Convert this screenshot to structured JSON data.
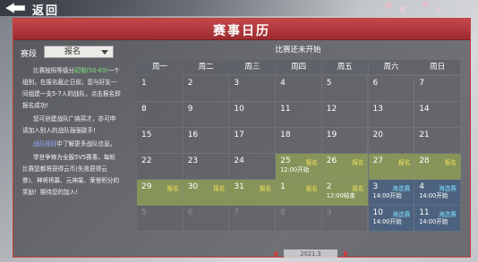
{
  "header": {
    "back_label": "返回"
  },
  "panel": {
    "title": "赛事日历"
  },
  "sidebar": {
    "segment_label": "赛段",
    "segment_value": "报名",
    "desc": {
      "p1_a": "比赛按照等级分",
      "p1_range": "初期(50-69)",
      "p1_b": "一个组别，在报名截止日前，您与好友一同组建一支5-7人的战队，点击报名即报名成功!",
      "p2": "您可创建战队广纳英才，亦可申请加入别人的战队强强联手!",
      "p3_link": "战队规则",
      "p3_b": "中了解更多战队信息。",
      "p4": "举世争锋为全服5V5赛事，每轮比赛您都将获得云币(失败获得云券)、神将将募、元神果、荣誉积分的奖励！期待您的加入!"
    }
  },
  "calendar": {
    "status": "比赛还未开始",
    "weekdays": [
      "周一",
      "周二",
      "周三",
      "周四",
      "周五",
      "周六",
      "周日"
    ],
    "rows": [
      [
        {
          "d": "1"
        },
        {
          "d": "2"
        },
        {
          "d": "3"
        },
        {
          "d": "4"
        },
        {
          "d": "5"
        },
        {
          "d": "6"
        },
        {
          "d": "7"
        }
      ],
      [
        {
          "d": "8"
        },
        {
          "d": "9"
        },
        {
          "d": "10"
        },
        {
          "d": "11"
        },
        {
          "d": "12"
        },
        {
          "d": "13"
        },
        {
          "d": "14"
        }
      ],
      [
        {
          "d": "15"
        },
        {
          "d": "16"
        },
        {
          "d": "17"
        },
        {
          "d": "18"
        },
        {
          "d": "19"
        },
        {
          "d": "20"
        },
        {
          "d": "21"
        }
      ],
      [
        {
          "d": "22"
        },
        {
          "d": "23"
        },
        {
          "d": "24"
        },
        {
          "d": "25",
          "tag": "报名",
          "sub": "12:00开始",
          "style": "reg"
        },
        {
          "d": "26",
          "tag": "报名",
          "style": "reg"
        },
        {
          "d": "27",
          "tag": "报名",
          "style": "reg"
        },
        {
          "d": "28",
          "tag": "报名",
          "style": "reg"
        }
      ],
      [
        {
          "d": "29",
          "tag": "报名",
          "style": "reg"
        },
        {
          "d": "30",
          "tag": "报名",
          "style": "reg"
        },
        {
          "d": "31",
          "tag": "报名",
          "style": "reg"
        },
        {
          "d": "1",
          "tag": "报名",
          "style": "reg"
        },
        {
          "d": "2",
          "tag": "报名",
          "sub": "12:00结束",
          "style": "reg"
        },
        {
          "d": "3",
          "tag": "海选赛",
          "sub": "14:00开始",
          "style": "blue"
        },
        {
          "d": "4",
          "tag": "海选赛",
          "sub": "14:00开始",
          "style": "blue"
        }
      ],
      [
        {
          "d": "5",
          "style": "dim"
        },
        {
          "d": "6",
          "style": "dim"
        },
        {
          "d": "7",
          "style": "dim"
        },
        {
          "d": "8",
          "style": "dim"
        },
        {
          "d": "9",
          "style": "dim"
        },
        {
          "d": "10",
          "tag": "海选赛",
          "sub": "14:00开始",
          "style": "blue"
        },
        {
          "d": "11",
          "tag": "海选赛",
          "sub": "14:00开始",
          "style": "blue"
        }
      ]
    ],
    "month": "2021.3"
  },
  "colors": {
    "accent": "#c5474a",
    "register": "#8c9c54",
    "selection": "#4a6080",
    "tag_yellow": "#f2e25a"
  }
}
